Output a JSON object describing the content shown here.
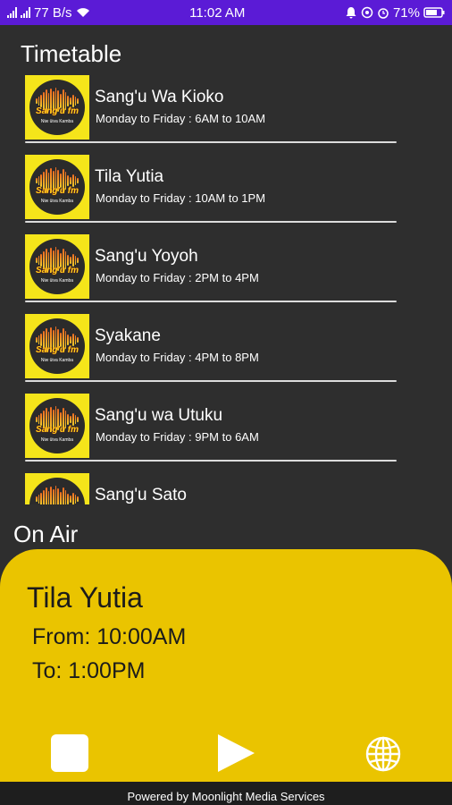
{
  "status_bar": {
    "net_speed": "77 B/s",
    "time": "11:02 AM",
    "battery": "71%"
  },
  "timetable": {
    "title": "Timetable",
    "logo_text": "Sang'u fm",
    "logo_tagline": "Niw ūiva Kamba",
    "items": [
      {
        "name": "Sang'u Wa Kioko",
        "schedule": "Monday to Friday : 6AM to 10AM"
      },
      {
        "name": "Tila Yutia",
        "schedule": "Monday to Friday : 10AM to 1PM"
      },
      {
        "name": "Sang'u Yoyoh",
        "schedule": "Monday to Friday : 2PM to 4PM"
      },
      {
        "name": "Syakane",
        "schedule": "Monday to Friday : 4PM to 8PM"
      },
      {
        "name": "Sang'u wa Utuku",
        "schedule": "Monday to Friday : 9PM to 6AM"
      },
      {
        "name": "Sang'u Sato",
        "schedule": ""
      }
    ]
  },
  "on_air": {
    "title": "On Air",
    "show_name": "Tila Yutia",
    "from": "From: 10:00AM",
    "to": "To: 1:00PM"
  },
  "controls": {
    "stop_icon": "stop-icon",
    "play_icon": "play-icon",
    "globe_icon": "globe-icon"
  },
  "footer": {
    "text": "Powered by Moonlight Media Services"
  },
  "colors": {
    "status_bar": "#5b1bd6",
    "background": "#2e2e2e",
    "accent_yellow": "#eac400",
    "thumb_yellow": "#f5e51a"
  }
}
